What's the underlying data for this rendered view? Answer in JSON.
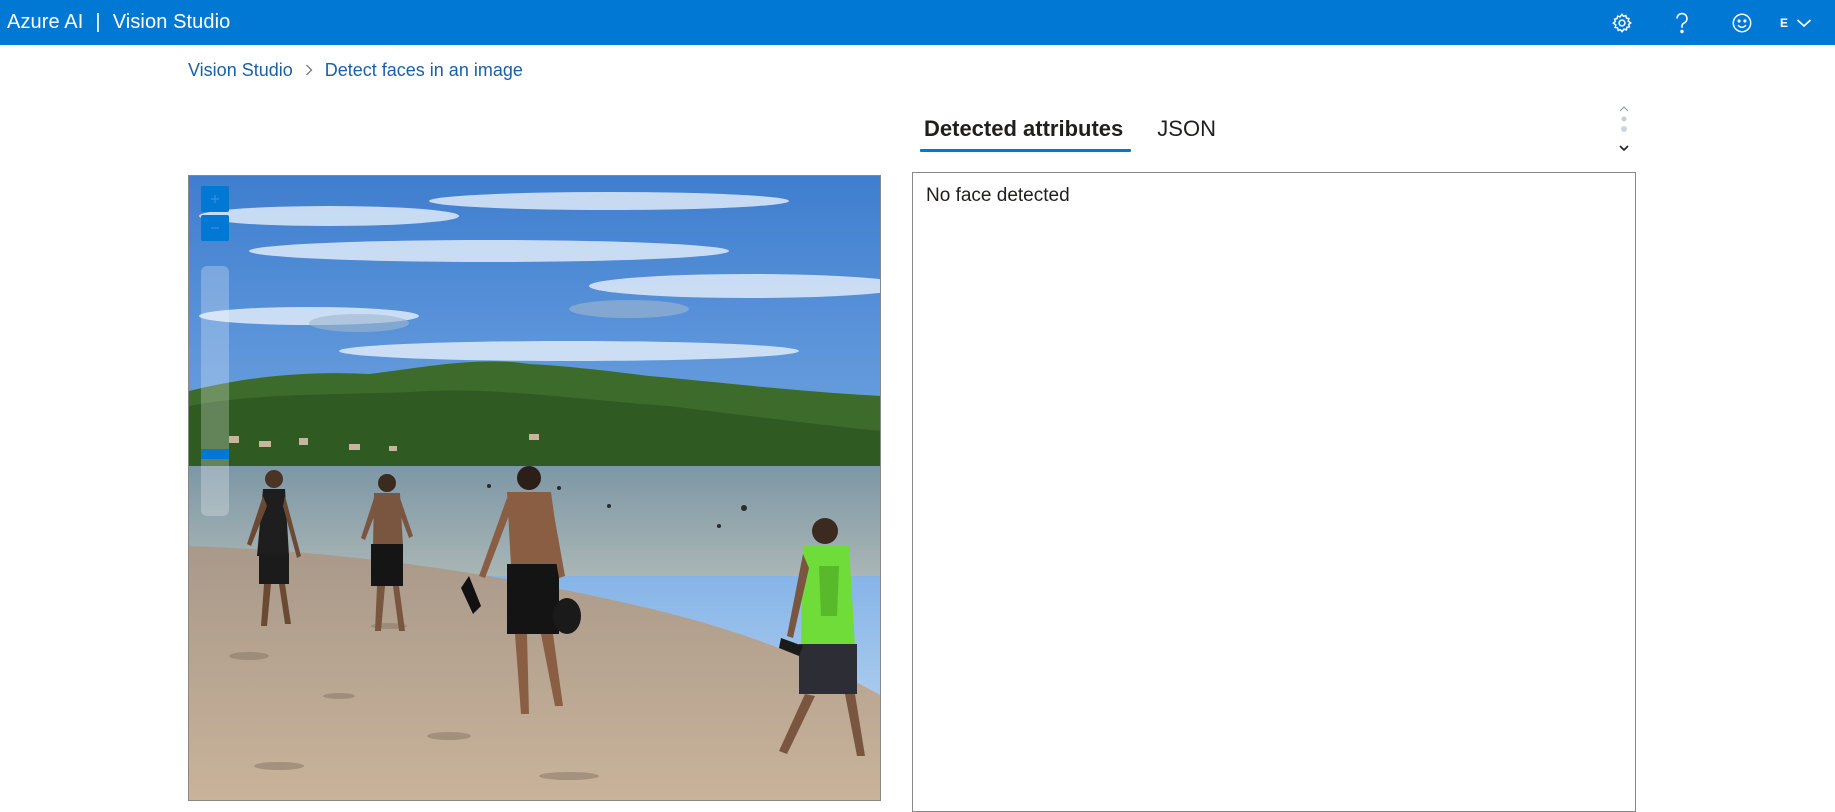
{
  "header": {
    "product": "Azure AI",
    "separator": "|",
    "app": "Vision Studio",
    "avatar_initial": "E",
    "icons": [
      "gear-icon",
      "help-icon",
      "feedback-smiley-icon",
      "chevron-down-icon"
    ]
  },
  "breadcrumb": {
    "items": [
      {
        "label": "Vision Studio"
      },
      {
        "label": "Detect faces in an image"
      }
    ]
  },
  "image_viewer": {
    "zoom_controls": [
      "zoom-in-icon",
      "zoom-out-icon"
    ],
    "zoom_level_fraction": 0.85
  },
  "tabs": [
    {
      "label": "Detected attributes",
      "active": true
    },
    {
      "label": "JSON",
      "active": false
    }
  ],
  "results": {
    "message": "No face detected"
  },
  "colors": {
    "accent": "#0078d4",
    "link": "#1a5fa8",
    "text": "#201f1e",
    "border": "#8a8886"
  }
}
